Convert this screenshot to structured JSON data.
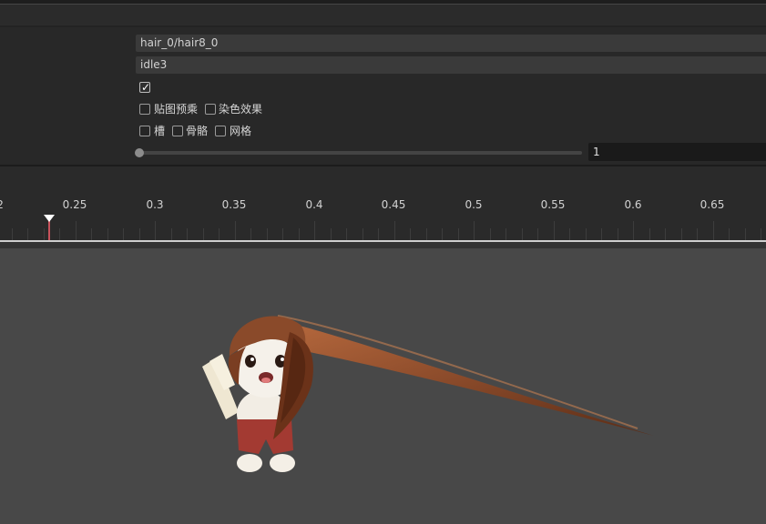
{
  "props": {
    "skin_value": "hair_0/hair8_0",
    "animation_value": "idle3",
    "loop_checked": true,
    "premultiply_label": "贴图预乘",
    "tint_label": "染色效果",
    "slot_label": "槽",
    "bone_label": "骨骼",
    "mesh_label": "网格",
    "speed_value": "1"
  },
  "timeline": {
    "ticks": [
      "2",
      "0.25",
      "0.3",
      "0.35",
      "0.4",
      "0.45",
      "0.5",
      "0.55",
      "0.6",
      "0.65"
    ],
    "playhead_time": 0.237
  },
  "colors": {
    "accent_playhead": "#c8525b",
    "viewport_bg": "#484848",
    "hair": "#8a4a2a"
  },
  "icons": {
    "check": "checkmark-icon",
    "playhead": "playhead-marker-icon"
  }
}
